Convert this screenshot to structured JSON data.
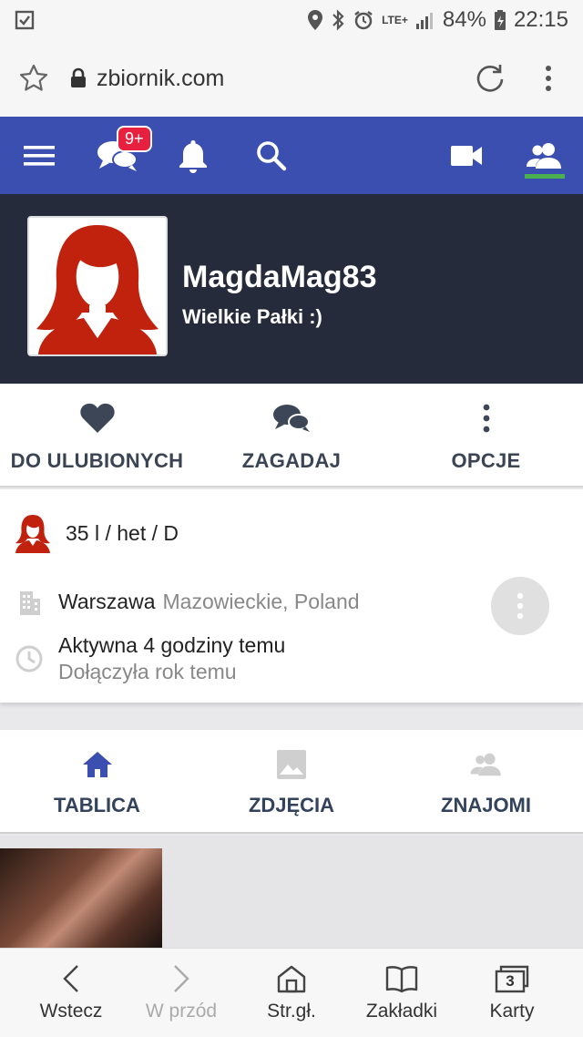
{
  "status_bar": {
    "battery": "84%",
    "time": "22:15",
    "network": "LTE+"
  },
  "browser": {
    "url": "zbiornik.com"
  },
  "nav": {
    "messages_badge": "9+"
  },
  "profile": {
    "username": "MagdaMag83",
    "tagline": "Wielkie Pałki :)"
  },
  "actions": {
    "favorite": "DO ULUBIONYCH",
    "message": "ZAGADAJ",
    "options": "OPCJE"
  },
  "info": {
    "demographics": "35 l / het / D",
    "city": "Warszawa",
    "region": "Mazowieckie, Poland",
    "active": "Aktywna 4 godziny temu",
    "joined": "Dołączyła rok temu"
  },
  "tabs": {
    "wall": "TABLICA",
    "photos": "ZDJĘCIA",
    "friends": "ZNAJOMI"
  },
  "bottom_bar": {
    "back": "Wstecz",
    "forward": "W przód",
    "home": "Str.gł.",
    "bookmarks": "Zakładki",
    "tabs": "Karty",
    "tabs_count": "3"
  },
  "colors": {
    "nav_bg": "#3b4fb0",
    "header_bg": "#262b3b",
    "active_tab": "#3b4fb0",
    "friends_indicator": "#4cb050",
    "badge": "#e8203f",
    "avatar_red": "#c0220d"
  }
}
